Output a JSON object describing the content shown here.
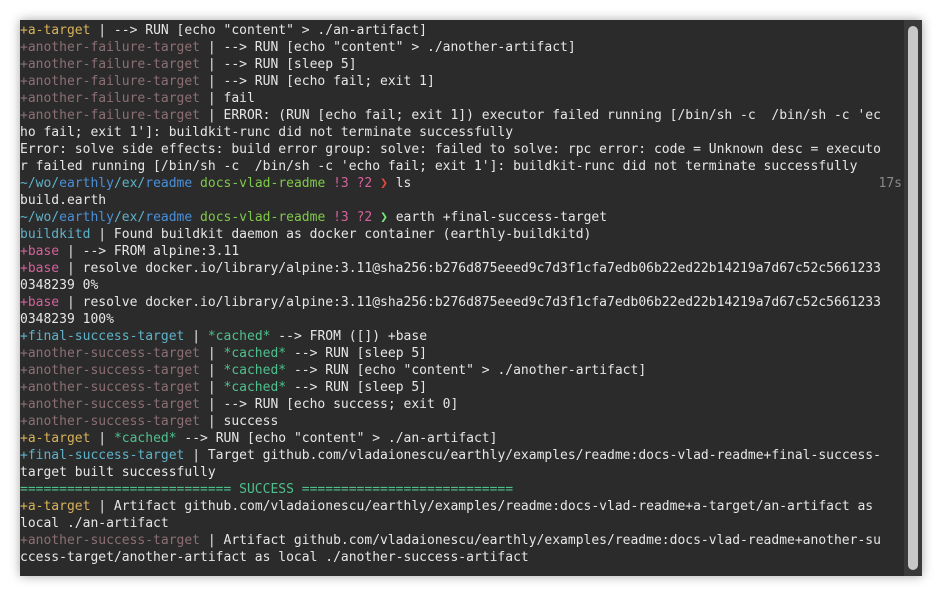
{
  "terminal": {
    "lines": [
      {
        "parts": [
          {
            "t": "+a-target",
            "c": "c-yellow"
          },
          {
            "t": " | --> RUN [echo \"content\" > ./an-artifact]"
          }
        ]
      },
      {
        "parts": [
          {
            "t": "+another-failure-target",
            "c": "c-pink"
          },
          {
            "t": " | --> RUN [echo \"content\" > ./another-artifact]"
          }
        ]
      },
      {
        "parts": [
          {
            "t": "+another-failure-target",
            "c": "c-pink"
          },
          {
            "t": " | --> RUN [sleep 5]"
          }
        ]
      },
      {
        "parts": [
          {
            "t": "+another-failure-target",
            "c": "c-pink"
          },
          {
            "t": " | --> RUN [echo fail; exit 1]"
          }
        ]
      },
      {
        "parts": [
          {
            "t": "+another-failure-target",
            "c": "c-pink"
          },
          {
            "t": " | fail"
          }
        ]
      },
      {
        "parts": [
          {
            "t": "+another-failure-target",
            "c": "c-pink"
          },
          {
            "t": " | ERROR: (RUN [echo fail; exit 1]) executor failed running [/bin/sh -c  /bin/sh -c 'ec"
          }
        ]
      },
      {
        "parts": [
          {
            "t": "ho fail; exit 1']: buildkit-runc did not terminate successfully"
          }
        ]
      },
      {
        "parts": [
          {
            "t": "Error: solve side effects: build error group: solve: failed to solve: rpc error: code = Unknown desc = executo"
          }
        ]
      },
      {
        "parts": [
          {
            "t": "r failed running [/bin/sh -c  /bin/sh -c 'echo fail; exit 1']: buildkit-runc did not terminate successfully"
          }
        ]
      },
      {
        "parts": [
          {
            "t": "~/wo/",
            "c": "c-cyan"
          },
          {
            "t": "earthly",
            "c": "c-blue"
          },
          {
            "t": "/ex/",
            "c": "c-cyan"
          },
          {
            "t": "readme",
            "c": "c-blue"
          },
          {
            "t": " "
          },
          {
            "t": "docs-vlad-readme",
            "c": "c-lime"
          },
          {
            "t": " "
          },
          {
            "t": "!3 ?2",
            "c": "c-pink2"
          },
          {
            "t": " "
          },
          {
            "t": "❯",
            "c": "c-red"
          },
          {
            "t": " ls"
          }
        ],
        "right": "17s"
      },
      {
        "parts": [
          {
            "t": "build.earth"
          }
        ]
      },
      {
        "parts": [
          {
            "t": "~/wo/",
            "c": "c-cyan"
          },
          {
            "t": "earthly",
            "c": "c-blue"
          },
          {
            "t": "/ex/",
            "c": "c-cyan"
          },
          {
            "t": "readme",
            "c": "c-blue"
          },
          {
            "t": " "
          },
          {
            "t": "docs-vlad-readme",
            "c": "c-lime"
          },
          {
            "t": " "
          },
          {
            "t": "!3 ?2",
            "c": "c-pink2"
          },
          {
            "t": " "
          },
          {
            "t": "❯",
            "c": "c-bright"
          },
          {
            "t": " earth +final-success-target"
          }
        ]
      },
      {
        "parts": [
          {
            "t": "buildkitd",
            "c": "c-cyan"
          },
          {
            "t": " | Found buildkit daemon as docker container (earthly-buildkitd)"
          }
        ]
      },
      {
        "parts": [
          {
            "t": "+base",
            "c": "c-pink2"
          },
          {
            "t": " | --> FROM alpine:3.11"
          }
        ]
      },
      {
        "parts": [
          {
            "t": "+base",
            "c": "c-pink2"
          },
          {
            "t": " | resolve docker.io/library/alpine:3.11@sha256:b276d875eeed9c7d3f1cfa7edb06b22ed22b14219a7d67c52c5661233"
          }
        ]
      },
      {
        "parts": [
          {
            "t": "0348239 0%"
          }
        ]
      },
      {
        "parts": [
          {
            "t": "+base",
            "c": "c-pink2"
          },
          {
            "t": " | resolve docker.io/library/alpine:3.11@sha256:b276d875eeed9c7d3f1cfa7edb06b22ed22b14219a7d67c52c5661233"
          }
        ]
      },
      {
        "parts": [
          {
            "t": "0348239 100%"
          }
        ]
      },
      {
        "parts": [
          {
            "t": "+final-success-target",
            "c": "c-cyan"
          },
          {
            "t": " | "
          },
          {
            "t": "*cached*",
            "c": "c-green"
          },
          {
            "t": " --> FROM ([]) +base"
          }
        ]
      },
      {
        "parts": [
          {
            "t": "+another-success-target",
            "c": "c-pink"
          },
          {
            "t": " | "
          },
          {
            "t": "*cached*",
            "c": "c-green"
          },
          {
            "t": " --> RUN [sleep 5]"
          }
        ]
      },
      {
        "parts": [
          {
            "t": "+another-success-target",
            "c": "c-pink"
          },
          {
            "t": " | "
          },
          {
            "t": "*cached*",
            "c": "c-green"
          },
          {
            "t": " --> RUN [echo \"content\" > ./another-artifact]"
          }
        ]
      },
      {
        "parts": [
          {
            "t": "+another-success-target",
            "c": "c-pink"
          },
          {
            "t": " | "
          },
          {
            "t": "*cached*",
            "c": "c-green"
          },
          {
            "t": " --> RUN [sleep 5]"
          }
        ]
      },
      {
        "parts": [
          {
            "t": "+another-success-target",
            "c": "c-pink"
          },
          {
            "t": " | --> RUN [echo success; exit 0]"
          }
        ]
      },
      {
        "parts": [
          {
            "t": "+another-success-target",
            "c": "c-pink"
          },
          {
            "t": " | success"
          }
        ]
      },
      {
        "parts": [
          {
            "t": "+a-target",
            "c": "c-yellow"
          },
          {
            "t": " | "
          },
          {
            "t": "*cached*",
            "c": "c-green"
          },
          {
            "t": " --> RUN [echo \"content\" > ./an-artifact]"
          }
        ]
      },
      {
        "parts": [
          {
            "t": "+final-success-target",
            "c": "c-cyan"
          },
          {
            "t": " | Target github.com/vladaionescu/earthly/examples/readme:docs-vlad-readme+final-success-"
          }
        ]
      },
      {
        "parts": [
          {
            "t": "target built successfully"
          }
        ]
      },
      {
        "parts": [
          {
            "t": "=========================== SUCCESS ===========================",
            "c": "c-green"
          }
        ]
      },
      {
        "parts": [
          {
            "t": "+a-target",
            "c": "c-yellow"
          },
          {
            "t": " | Artifact github.com/vladaionescu/earthly/examples/readme:docs-vlad-readme+a-target/an-artifact as"
          }
        ]
      },
      {
        "parts": [
          {
            "t": "local ./an-artifact"
          }
        ]
      },
      {
        "parts": [
          {
            "t": "+another-success-target",
            "c": "c-pink"
          },
          {
            "t": " | Artifact github.com/vladaionescu/earthly/examples/readme:docs-vlad-readme+another-su"
          }
        ]
      },
      {
        "parts": [
          {
            "t": "ccess-target/another-artifact as local ./another-success-artifact"
          }
        ]
      }
    ]
  }
}
